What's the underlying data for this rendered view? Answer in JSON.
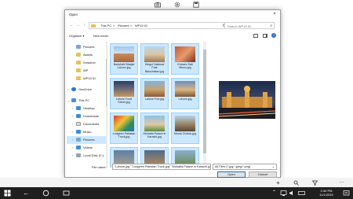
{
  "dialog": {
    "title": "Open",
    "close_glyph": "×"
  },
  "address": {
    "back_glyph": "←",
    "forward_glyph": "→",
    "up_glyph": "↑",
    "segments": [
      "This PC",
      ">",
      "Pictures",
      ">",
      "WP10 ID"
    ],
    "search_placeholder": "Search WP10 ID"
  },
  "toolbar": {
    "organize_label": "Organize ▾",
    "new_folder_label": "New folder"
  },
  "nav": {
    "items": [
      {
        "label": "Pictures"
      },
      {
        "label": "Assets"
      },
      {
        "label": "Smasher"
      },
      {
        "label": "WP"
      },
      {
        "label": "WP10 ID"
      },
      {
        "label": "OneDrive"
      },
      {
        "label": "This PC"
      },
      {
        "label": "Desktop"
      },
      {
        "label": "Downloads"
      },
      {
        "label": "Documents"
      },
      {
        "label": "Music"
      },
      {
        "label": "Pictures"
      },
      {
        "label": "Videos"
      },
      {
        "label": "Local Disk (C:)"
      }
    ]
  },
  "files": [
    {
      "name": "Badshahi Masjid Lahore.jpg"
    },
    {
      "name": "Hingol National Park Baluchistan.jpg"
    },
    {
      "name": "Khewra Salt Mines.jpg"
    },
    {
      "name": "Lahore Food Street.jpg"
    },
    {
      "name": "Lahore Fort.jpg"
    },
    {
      "name": "Lahore.jpg"
    },
    {
      "name": "Lodgeen Pakistan Truck.jpg"
    },
    {
      "name": "Mohatta Palace in Karachi.jpg"
    },
    {
      "name": "Moola Chotok.jpg"
    }
  ],
  "bottom": {
    "filename_label": "File name:",
    "filename_value": "\"Lahore.jpg\" \"Lodgeen Pakistan Truck.jpg\" \"Mohatta Palace in Karachi.jpg\" \"I",
    "filter_value": "All Files (*.jpg;*.jpeg;*.png)",
    "open_label": "Open",
    "cancel_label": "Cancel"
  },
  "taskbar": {
    "time": "2:40 PM",
    "date": "11/1/2016"
  },
  "colors": {
    "accent": "#0078d7",
    "selection": "#cce8ff"
  }
}
